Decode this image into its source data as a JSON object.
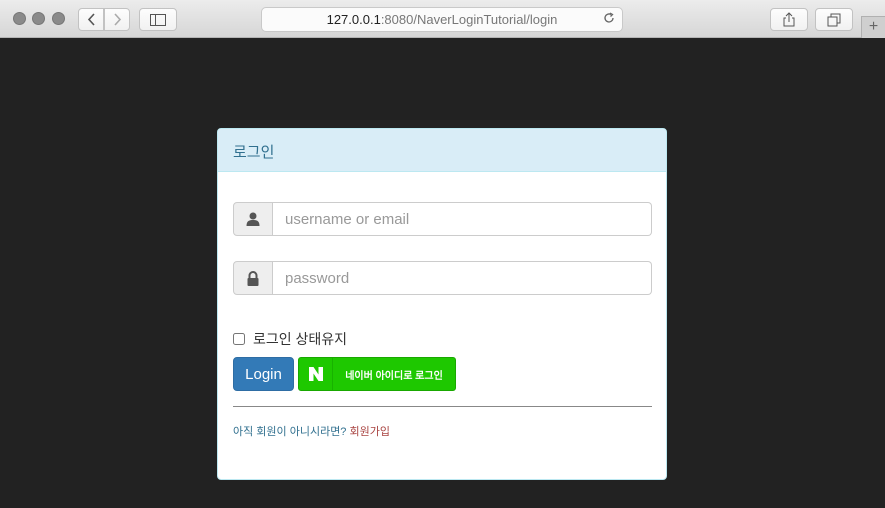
{
  "browser": {
    "url_host": "127.0.0.1",
    "url_rest": ":8080/NaverLoginTutorial/login"
  },
  "login": {
    "heading": "로그인",
    "username_placeholder": "username or email",
    "password_placeholder": "password",
    "remember_label": "로그인 상태유지",
    "login_button": "Login",
    "naver_button": "네이버 아이디로 로그인",
    "signup_prompt": "아직 회원이 아니시라면?",
    "signup_link": "회원가입"
  },
  "colors": {
    "page_bg": "#222222",
    "panel_heading_bg": "#d9edf7",
    "primary": "#337ab7",
    "naver_green": "#1ec800"
  }
}
